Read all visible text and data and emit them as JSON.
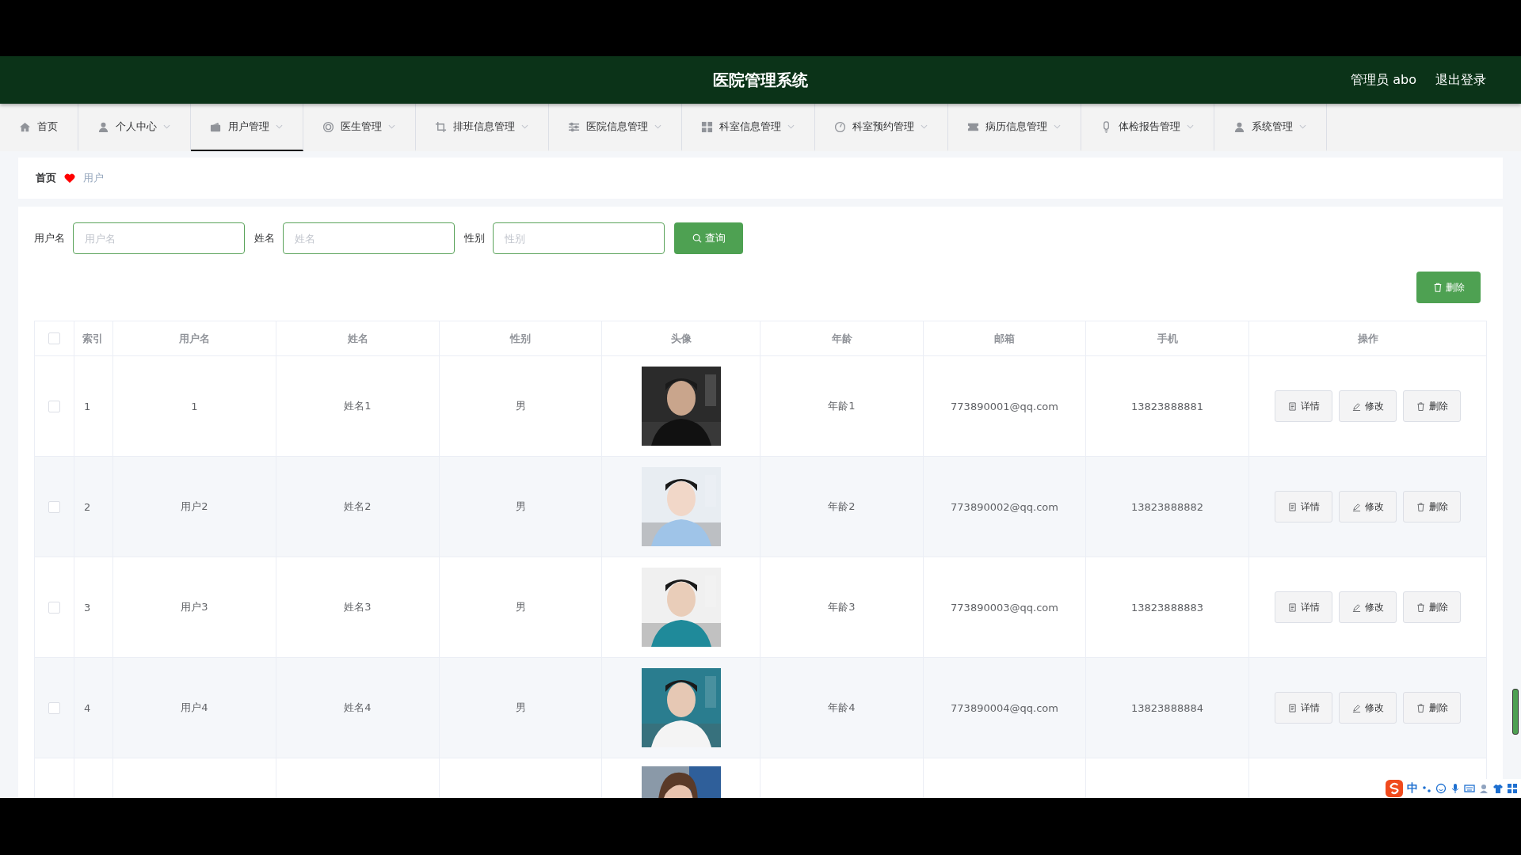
{
  "header": {
    "title": "医院管理系统",
    "user": "管理员 abo",
    "logout": "退出登录"
  },
  "nav": [
    {
      "label": "首页",
      "selected": false,
      "dropdown": false
    },
    {
      "label": "个人中心",
      "selected": false,
      "dropdown": true
    },
    {
      "label": "用户管理",
      "selected": true,
      "dropdown": true
    },
    {
      "label": "医生管理",
      "selected": false,
      "dropdown": true
    },
    {
      "label": "排班信息管理",
      "selected": false,
      "dropdown": true
    },
    {
      "label": "医院信息管理",
      "selected": false,
      "dropdown": true
    },
    {
      "label": "科室信息管理",
      "selected": false,
      "dropdown": true
    },
    {
      "label": "科室预约管理",
      "selected": false,
      "dropdown": true
    },
    {
      "label": "病历信息管理",
      "selected": false,
      "dropdown": true
    },
    {
      "label": "体检报告管理",
      "selected": false,
      "dropdown": true
    },
    {
      "label": "系统管理",
      "selected": false,
      "dropdown": true
    }
  ],
  "breadcrumb": [
    "首页",
    "用户"
  ],
  "search": [
    {
      "label": "用户名",
      "placeholder": "用户名"
    },
    {
      "label": "姓名",
      "placeholder": "姓名"
    },
    {
      "label": "性别",
      "placeholder": "性别"
    }
  ],
  "search_button": "查询",
  "delete_button": "删除",
  "table": {
    "select_all_checked": false,
    "columns": [
      "索引",
      "用户名",
      "姓名",
      "性别",
      "头像",
      "年龄",
      "邮箱",
      "手机",
      "操作"
    ],
    "rows": [
      {
        "checked": false,
        "index": "1",
        "username": "1",
        "name": "姓名1",
        "gender": "男",
        "avatar": {
          "kind": "picture"
        },
        "age": "年龄1",
        "email": "773890001@qq.com",
        "phone": "13823888881",
        "actions": [
          "详情",
          "修改",
          "删除"
        ]
      },
      {
        "checked": false,
        "index": "2",
        "username": "用户2",
        "name": "姓名2",
        "gender": "男",
        "avatar": {
          "kind": "picture"
        },
        "age": "年龄2",
        "email": "773890002@qq.com",
        "phone": "13823888882",
        "actions": [
          "详情",
          "修改",
          "删除"
        ]
      },
      {
        "checked": false,
        "index": "3",
        "username": "用户3",
        "name": "姓名3",
        "gender": "男",
        "avatar": {
          "kind": "picture"
        },
        "age": "年龄3",
        "email": "773890003@qq.com",
        "phone": "13823888883",
        "actions": [
          "详情",
          "修改",
          "删除"
        ]
      },
      {
        "checked": false,
        "index": "4",
        "username": "用户4",
        "name": "姓名4",
        "gender": "男",
        "avatar": {
          "kind": "picture"
        },
        "age": "年龄4",
        "email": "773890004@qq.com",
        "phone": "13823888884",
        "actions": [
          "详情",
          "修改",
          "删除"
        ]
      }
    ],
    "partial_row": true
  },
  "ime_toolbar": {
    "label": "中"
  }
}
